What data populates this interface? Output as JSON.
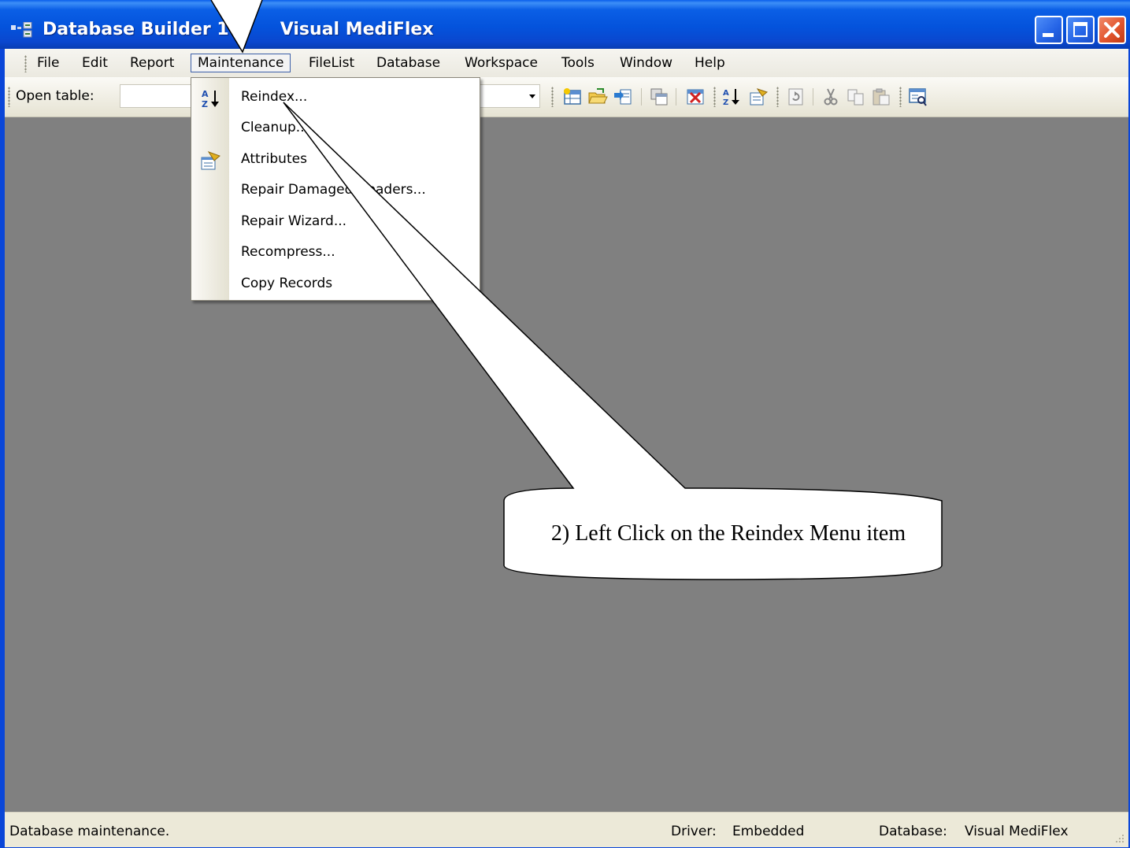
{
  "window": {
    "title": "Database Builder 14.",
    "title_suffix": "Visual MediFlex",
    "buttons": {
      "minimize": "minimize-icon",
      "maximize": "maximize-icon",
      "close": "close-icon"
    }
  },
  "menubar": {
    "items": [
      "File",
      "Edit",
      "Report",
      "Maintenance",
      "FileList",
      "Database",
      "Workspace",
      "Tools",
      "Window",
      "Help"
    ],
    "active": "Maintenance"
  },
  "toolbar": {
    "open_table_label": "Open table:",
    "open_table_value": "",
    "icons": [
      "new-table-icon",
      "open-folder-icon",
      "import-icon",
      "copy-table-icon",
      "delete-table-icon",
      "sort-icon",
      "attributes-icon",
      "refresh-icon",
      "cut-icon",
      "copy-icon",
      "paste-icon",
      "view-icon"
    ]
  },
  "maintenance_menu": {
    "items": [
      {
        "label": "Reindex...",
        "icon": "sort-az-icon"
      },
      {
        "label": "Cleanup...",
        "icon": ""
      },
      {
        "label": "Attributes",
        "icon": "attributes-icon"
      },
      {
        "label": "Repair Damaged Headers...",
        "icon": ""
      },
      {
        "label": "Repair Wizard...",
        "icon": ""
      },
      {
        "label": "Recompress...",
        "icon": ""
      },
      {
        "label": "Copy Records",
        "icon": ""
      }
    ]
  },
  "status": {
    "message": "Database maintenance.",
    "driver_label": "Driver:",
    "driver_value": "Embedded",
    "database_label": "Database:",
    "database_value": "Visual MediFlex"
  },
  "annotation": {
    "callout_text": "2) Left Click on the Reindex Menu item"
  }
}
